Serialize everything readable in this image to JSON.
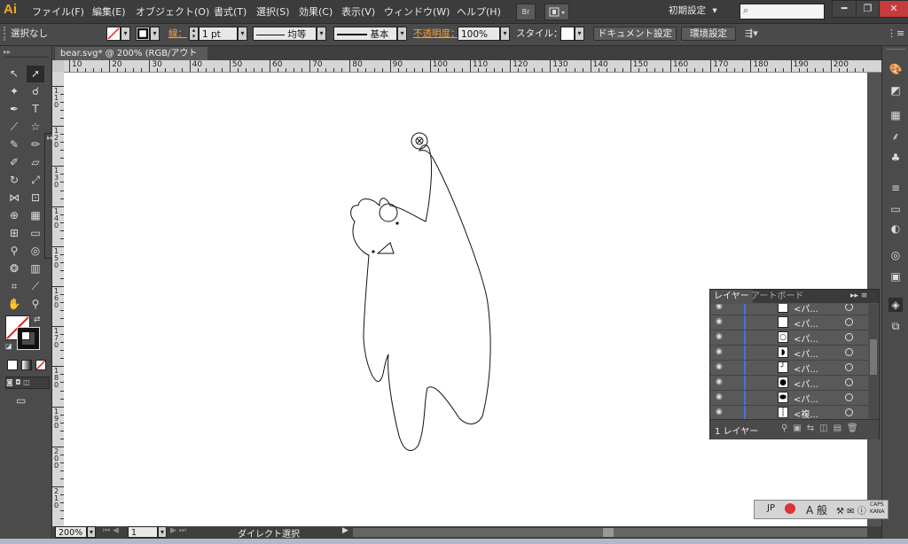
{
  "app": {
    "logo": "Ai"
  },
  "menu": [
    "ファイル(F)",
    "編集(E)",
    "オブジェクト(O)",
    "書式(T)",
    "選択(S)",
    "効果(C)",
    "表示(V)",
    "ウィンドウ(W)",
    "ヘルプ(H)"
  ],
  "appbar": {
    "bridge": "Br",
    "workspace": "初期設定",
    "workspace_arrow": "▾",
    "search_icon": "⌕"
  },
  "window_controls": {
    "minimize": "━",
    "restore": "❐",
    "close": "✕"
  },
  "control": {
    "selection": "選択なし",
    "stroke_label": "線：",
    "stroke_weight": "1 pt",
    "profile": "均等",
    "brush": "基本",
    "opacity_label": "不透明度：",
    "opacity": "100%",
    "style_label": "スタイル：",
    "doc_setup": "ドキュメント設定",
    "prefs": "環境設定"
  },
  "document": {
    "tab": "bear.svg* @ 200% (RGB/アウトライン)",
    "close": "×"
  },
  "rulers": {
    "h": [
      "10",
      "20",
      "30",
      "40",
      "50",
      "60",
      "70",
      "80",
      "90",
      "100",
      "110",
      "120",
      "130",
      "140",
      "150",
      "160",
      "170",
      "180",
      "190",
      "200"
    ],
    "v": [
      "110",
      "120",
      "130",
      "140",
      "150",
      "160",
      "170",
      "180",
      "190",
      "200",
      "210"
    ]
  },
  "layers": {
    "tabs": [
      "レイヤー",
      "アートボード"
    ],
    "menu_icon": "▸▸ ≡",
    "rows": [
      {
        "name": "<パ..."
      },
      {
        "name": "<パ..."
      },
      {
        "name": "<パ..."
      },
      {
        "name": "<パ..."
      },
      {
        "name": "<パ..."
      },
      {
        "name": "<パ..."
      },
      {
        "name": "<パ..."
      },
      {
        "name": "<複..."
      }
    ],
    "footer": "1 レイヤー"
  },
  "status": {
    "zoom": "200%",
    "page": "1",
    "tool": "ダイレクト選択"
  },
  "ime": {
    "lang": "JP",
    "mode": "般",
    "caps": "CAPS",
    "kana": "KANA"
  },
  "colors": {
    "accent": "#f5a623",
    "panel": "#535353",
    "dark": "#3c3c3c"
  }
}
